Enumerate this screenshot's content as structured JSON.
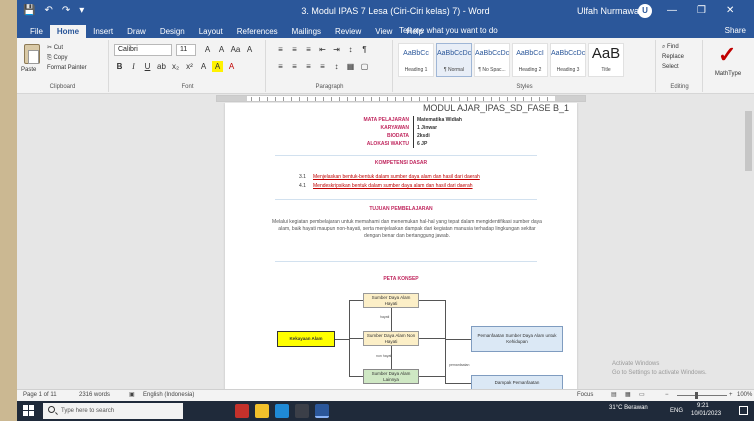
{
  "window": {
    "title": "3. Modul IPAS 7 Lesa (Ciri-Ciri kelas) 7) - Word",
    "user": "Ulfah Nurmawah",
    "avatar_initial": "U",
    "minimize": "—",
    "restore": "❐",
    "close": "✕",
    "qat": [
      "💾",
      "↶",
      "↷",
      "▾"
    ]
  },
  "tabs": [
    "File",
    "Home",
    "Insert",
    "Draw",
    "Design",
    "Layout",
    "References",
    "Mailings",
    "Review",
    "View",
    "Help"
  ],
  "tell_me": "Tell me what you want to do",
  "share": "Share",
  "ribbon": {
    "clipboard": {
      "label": "Clipboard",
      "paste": "Paste",
      "cut": "✂ Cut",
      "copy": "⎘ Copy",
      "format_painter": "Format Painter"
    },
    "font": {
      "label": "Font",
      "name": "Calibri",
      "size": "11",
      "row1": [
        "A",
        "A",
        "Aa",
        "A"
      ],
      "row2": [
        "B",
        "I",
        "U",
        "ab",
        "x₂",
        "x²",
        "A",
        "A",
        "A"
      ]
    },
    "paragraph": {
      "label": "Paragraph",
      "row1": [
        "≡",
        "≡",
        "≡",
        "⇤",
        "⇥",
        "↕",
        "¶"
      ],
      "row2": [
        "≡",
        "≡",
        "≡",
        "≡",
        "↕",
        "▦",
        "▢"
      ]
    },
    "styles": {
      "label": "Styles",
      "items": [
        {
          "preview": "AaBbCc",
          "name": "Heading 1"
        },
        {
          "preview": "AaBbCcDc",
          "name": "¶ Normal"
        },
        {
          "preview": "AaBbCcDc",
          "name": "¶ No Spac..."
        },
        {
          "preview": "AaBbCcI",
          "name": "Heading 2"
        },
        {
          "preview": "AaBbCcDc",
          "name": "Heading 3"
        },
        {
          "preview": "AaB",
          "name": "Title"
        }
      ]
    },
    "editing": {
      "label": "Editing",
      "find": "⌕ Find",
      "replace": "Replace",
      "select": "Select"
    },
    "mathtype": {
      "label": "MathType"
    }
  },
  "document": {
    "header": "MODUL AJAR_IPAS_SD_FASE B_1",
    "info": [
      {
        "label": "MATA PELAJARAN",
        "value": "Matematika Widiah"
      },
      {
        "label": "KARYAWAN",
        "value": "1 Jinwar"
      },
      {
        "label": "BIODATA",
        "value": "2ksdi"
      },
      {
        "label": "ALOKASI WAKTU",
        "value": "6 JP"
      }
    ],
    "competency_title": "KOMPETENSI DASAR",
    "competencies": [
      {
        "num": "3.1",
        "text": "Menjelaskan bentuk-bentuk dalam sumber daya alam dan hasil dari daerah"
      },
      {
        "num": "4.1",
        "text": "Mendeskripsikan bentuk dalam sumber daya alam dan hasil dari daerah"
      }
    ],
    "goal_title": "TUJUAN PEMBELAJARAN",
    "goal_text": "Melalui kegiatan pembelajaran untuk memahami dan menemukan hal-hal yang tepat dalam mengidentifikasi sumber daya alam, baik hayati maupun non-hayati, serta menjelaskan dampak dari kegiatan manusia terhadap lingkungan sekitar dengan benar dan bertanggung jawab.",
    "flow_title": "PETA KONSEP",
    "flow": {
      "center": "Kekayaan Alam",
      "top": "Sumber Daya Alam Hayati",
      "mid": "Sumber Daya Alam Non Hayati",
      "bottom": "Sumber Daya Alam Lainnya",
      "right_top": "Pemanfaatan Sumber Daya Alam untuk Kehidupan",
      "right_bottom": "Dampak Pemanfaatan",
      "label_a": "hayati",
      "label_b": "non hayati",
      "label_c": "pemanfaatan"
    }
  },
  "status": {
    "page": "Page 1 of 11",
    "words": "2316 words",
    "language": "English (Indonesia)",
    "focus": "Focus",
    "zoom": "100%"
  },
  "watermark_line1": "Activate Windows",
  "watermark_line2": "Go to Settings to activate Windows.",
  "taskbar": {
    "search_placeholder": "Type here to search",
    "time": "9:21",
    "date": "10/01/2023",
    "temperature": "31°C  Berawan",
    "lang": "ENG"
  }
}
